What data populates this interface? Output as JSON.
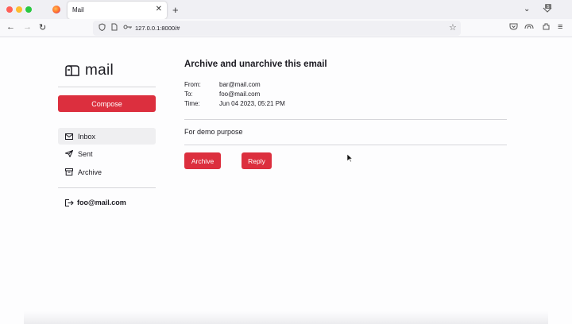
{
  "browser": {
    "tab_title": "Mail",
    "url": "127.0.0.1:8000/#",
    "notification_count": "5"
  },
  "app": {
    "logo_text": "mail",
    "compose_label": "Compose",
    "nav": [
      {
        "label": "Inbox",
        "icon": "inbox-icon"
      },
      {
        "label": "Sent",
        "icon": "send-icon"
      },
      {
        "label": "Archive",
        "icon": "archive-icon"
      }
    ],
    "user_email": "foo@mail.com"
  },
  "email": {
    "subject": "Archive and unarchive this email",
    "from_label": "From:",
    "from": "bar@mail.com",
    "to_label": "To:",
    "to": "foo@mail.com",
    "time_label": "Time:",
    "time": "Jun 04 2023, 05:21 PM",
    "body": "For demo purpose",
    "archive_label": "Archive",
    "reply_label": "Reply"
  },
  "colors": {
    "accent": "#dc2f3e"
  }
}
